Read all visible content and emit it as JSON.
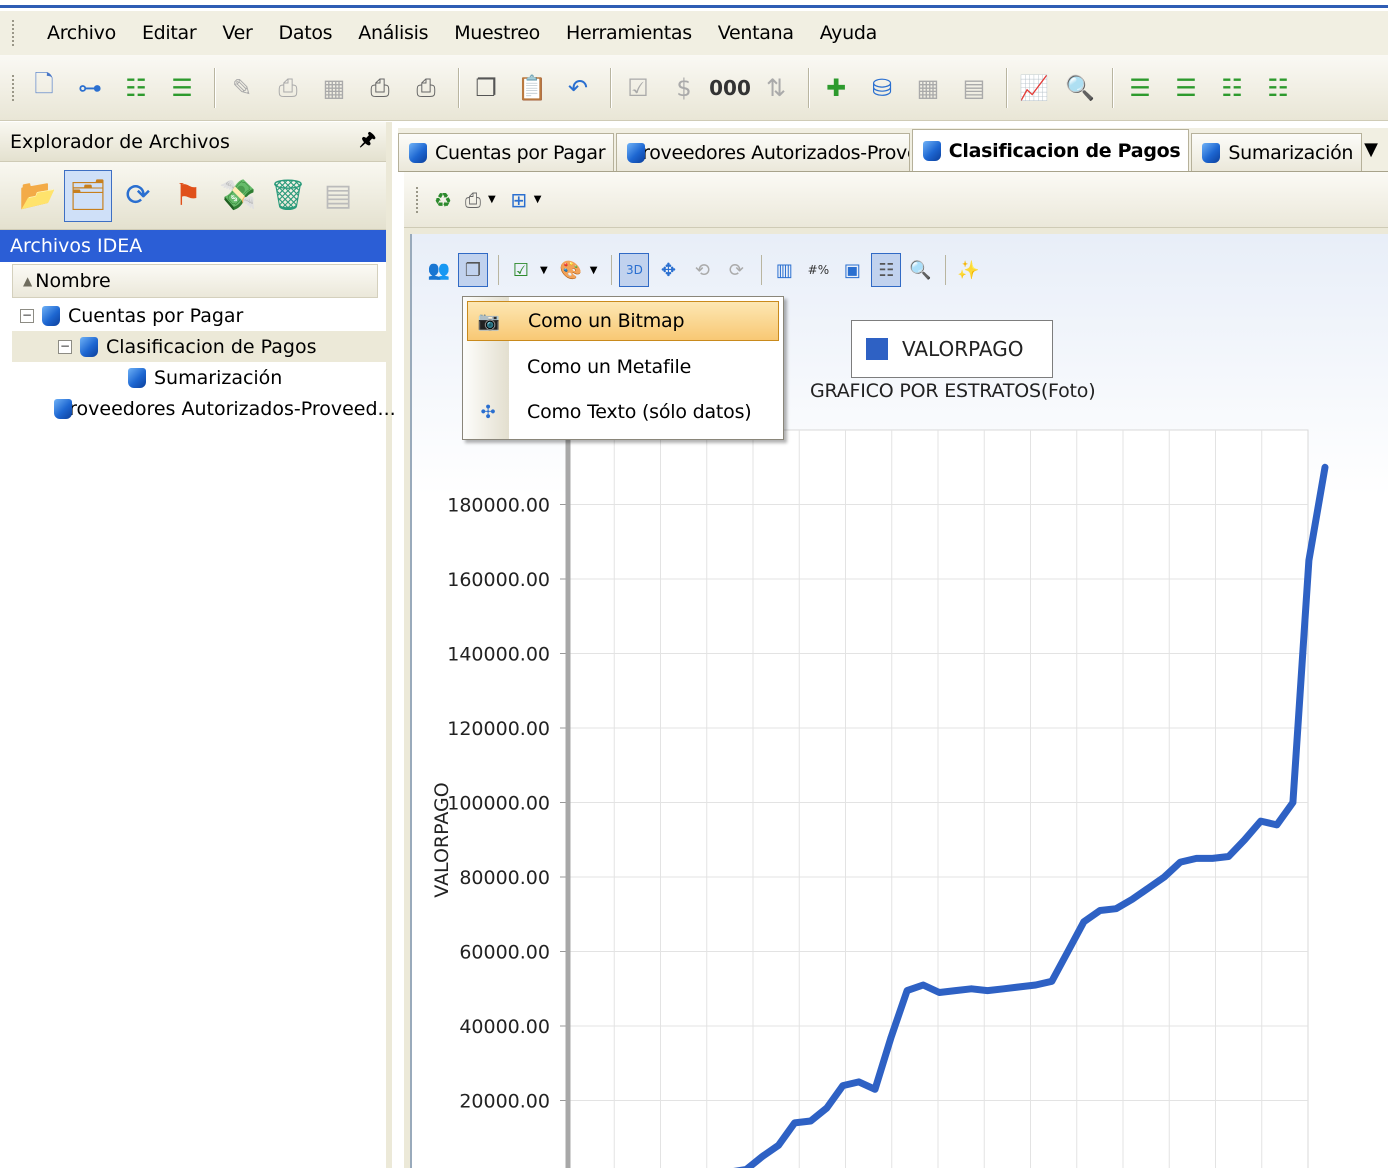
{
  "menubar": {
    "items": [
      "Archivo",
      "Editar",
      "Ver",
      "Datos",
      "Análisis",
      "Muestreo",
      "Herramientas",
      "Ventana",
      "Ayuda"
    ]
  },
  "explorer": {
    "header_title": "Explorador de Archivos",
    "pin_glyph": "🖈",
    "section_title": "Archivos IDEA",
    "column_header": "Nombre",
    "tree": [
      {
        "label": "Cuentas por Pagar",
        "level": 0,
        "expanded": true
      },
      {
        "label": "Clasificacion de Pagos",
        "level": 1,
        "expanded": true,
        "selected": true
      },
      {
        "label": "Sumarización",
        "level": 2
      },
      {
        "label": "Proveedores Autorizados-Proveed...",
        "level": 0
      }
    ]
  },
  "tabs": [
    {
      "label": "Cuentas por Pagar",
      "active": false
    },
    {
      "label": "Proveedores Autorizados-Proveedores",
      "active": false
    },
    {
      "label": "Clasificacion de Pagos",
      "active": true
    },
    {
      "label": "Sumarización",
      "active": false
    }
  ],
  "dropdown": {
    "items": [
      {
        "label": "Como un Bitmap",
        "icon": "camera-icon",
        "highlighted": true
      },
      {
        "label": "Como un Metafile",
        "icon": "",
        "highlighted": false
      },
      {
        "label": "Como Texto (sólo datos)",
        "icon": "text-export-icon",
        "highlighted": false
      }
    ]
  },
  "colors": {
    "series": "#2e61c4",
    "selection_blue": "#2b5ed6",
    "menu_highlight": "#f8c874"
  },
  "chart_data": {
    "type": "line",
    "title": "GRAFICO POR ESTRATOS(Foto)",
    "ylabel": "VALORPAGO",
    "xlabel": "",
    "legend": [
      "VALORPAGO"
    ],
    "legend_placement": "top-center",
    "grid": true,
    "ylim": [
      0,
      200000
    ],
    "yticks": [
      "20000.00",
      "40000.00",
      "60000.00",
      "80000.00",
      "100000.00",
      "120000.00",
      "140000.00",
      "160000.00",
      "180000.00"
    ],
    "series": [
      {
        "name": "VALORPAGO",
        "values": [
          0,
          0,
          100,
          200,
          300,
          800,
          1500,
          5000,
          8000,
          14000,
          14500,
          18000,
          24000,
          25000,
          23000,
          37000,
          49500,
          51000,
          49000,
          49500,
          50000,
          49500,
          50000,
          50500,
          51000,
          52000,
          60000,
          68000,
          71000,
          71500,
          74000,
          77000,
          80000,
          84000,
          85000,
          85000,
          85500,
          90000,
          95000,
          94000,
          100000,
          165000,
          190000
        ]
      }
    ]
  }
}
